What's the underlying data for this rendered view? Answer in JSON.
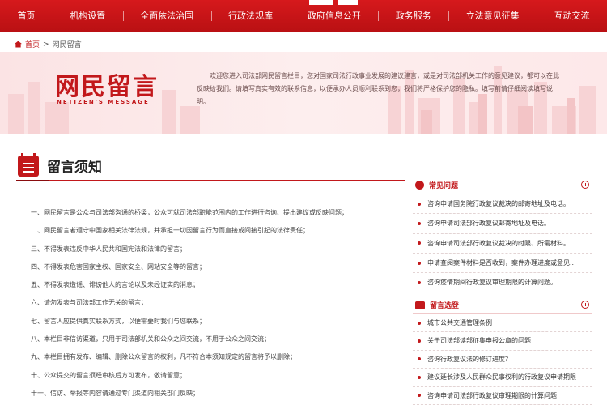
{
  "nav": {
    "items": [
      "首页",
      "机构设置",
      "全面依法治国",
      "行政法规库",
      "政府信息公开",
      "政务服务",
      "立法意见征集",
      "互动交流"
    ]
  },
  "breadcrumb": {
    "home": "首页",
    "separator": ">",
    "current": "网民留言"
  },
  "banner": {
    "title": "网民留言",
    "subtitle": "NETIZEN'S MESSAGE",
    "intro": "欢迎您进入司法部网民留言栏目，您对国家司法行政事业发展的建议建言，或是对司法部机关工作的意见建议，都可以在此反映给我们。请填写真实有效的联系信息，以便承办人员顺利联系到您，我们将严格保护您的隐私。填写前请仔细阅读填写说明。"
  },
  "notice": {
    "title": "留言须知",
    "rules": [
      "一、网民留言是公众与司法部沟通的桥梁，公众可就司法部职能范围内的工作进行咨询、提出建议或反映问题；",
      "二、网民留言者遵守中国家相关法律法规，并承担一切因留言行为而直接或间接引起的法律责任；",
      "三、不得发表违反中华人民共和国宪法和法律的留言；",
      "四、不得发表危害国家主权、国家安全、网站安全等的留言；",
      "五、不得发表造谣、诽谤他人的言论以及未经证实的消息；",
      "六、请勿发表与司法部工作无关的留言；",
      "七、留言人应提供真实联系方式，以便需要时我们与您联系；",
      "八、本栏目非信访渠道，只用于司法部机关和公众之间交流，不用于公众之间交流；",
      "九、本栏目拥有发布、编辑、删除公众留言的权利，凡不符合本须知规定的留言将予以删除；",
      "十、公众提交的留言须经审核后方可发布，敬请留意；",
      "十一、信访、举报等内容请通过专门渠道向相关部门反映；"
    ]
  },
  "faq": {
    "title": "常见问题",
    "items": [
      "咨询申请国务院行政复议裁决的邮寄地址及电话。",
      "咨询申请司法部行政复议邮寄地址及电话。",
      "咨询申请司法部行政复议裁决的时限、所需材料。",
      "申请查阅案件材料是否收到，案件办理进度或意见...",
      "咨询疫情期间行政复议审理期限的计算问题。"
    ]
  },
  "latest": {
    "title": "留言选登",
    "items": [
      "城市公共交通管理条例",
      "关于司法部读部征集申报公章的问题",
      "咨询行政复议法的修订进度？",
      "建议延长涉及人民群众民事权利的行政复议申请期限",
      "咨询申请司法部行政复议审理期限的计算问题"
    ]
  },
  "colors": {
    "brand_red": "#c2181b",
    "nav_red": "#d6191c",
    "banner_pink": "#fbe3e4"
  }
}
